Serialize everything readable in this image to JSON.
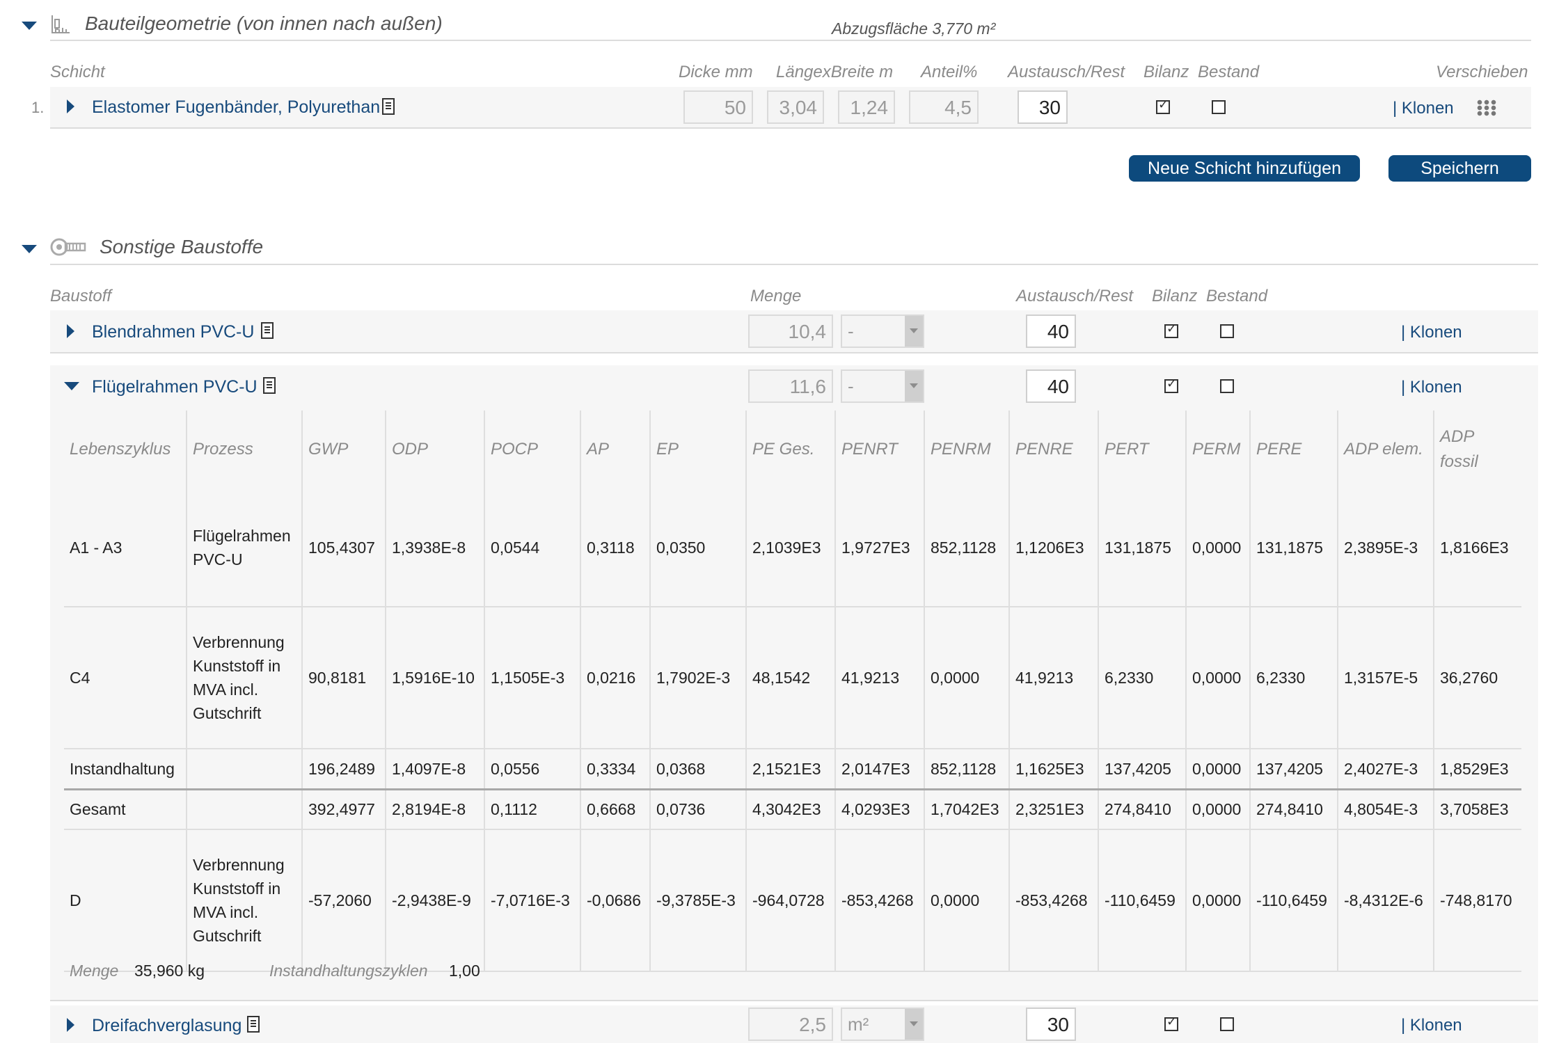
{
  "section1": {
    "title": "Bauteilgeometrie (von innen nach außen)",
    "deduction": "Abzugsfläche 3,770 m²",
    "headers": {
      "schicht": "Schicht",
      "dicke": "Dicke mm",
      "laenge_breite": "LängexBreite m",
      "anteil": "Anteil%",
      "austausch": "Austausch/Rest",
      "bilanz": "Bilanz",
      "bestand": "Bestand",
      "verschieben": "Verschieben"
    },
    "layer": {
      "index": "1.",
      "name": "Elastomer Fugenbänder, Polyurethan",
      "dicke": "50",
      "laenge": "3,04",
      "breite": "1,24",
      "anteil": "4,5",
      "austausch": "30",
      "bilanz": true,
      "bestand": false,
      "clone": "| Klonen"
    },
    "buttons": {
      "add_layer": "Neue Schicht hinzufügen",
      "save": "Speichern"
    }
  },
  "section2": {
    "title": "Sonstige Baustoffe",
    "headers": {
      "baustoff": "Baustoff",
      "menge": "Menge",
      "austausch": "Austausch/Rest",
      "bilanz": "Bilanz",
      "bestand": "Bestand"
    },
    "materials": [
      {
        "name": "Blendrahmen PVC-U",
        "menge": "10,4",
        "unit": "-",
        "austausch": "40",
        "bilanz": true,
        "bestand": false,
        "clone": "| Klonen"
      },
      {
        "name": "Flügelrahmen PVC-U",
        "menge": "11,6",
        "unit": "-",
        "austausch": "40",
        "bilanz": true,
        "bestand": false,
        "clone": "| Klonen"
      },
      {
        "name": "Dreifachverglasung",
        "menge": "2,5",
        "unit": "m²",
        "austausch": "30",
        "bilanz": true,
        "bestand": false,
        "clone": "| Klonen"
      }
    ],
    "lca_table": {
      "headers": [
        "Lebenszyklus",
        "Prozess",
        "GWP",
        "ODP",
        "POCP",
        "AP",
        "EP",
        "PE Ges.",
        "PENRT",
        "PENRM",
        "PENRE",
        "PERT",
        "PERM",
        "PERE",
        "ADP elem.",
        "ADP fossil"
      ],
      "rows": [
        {
          "cells": [
            "A1 - A3",
            "Flügelrahmen PVC-U",
            "105,4307",
            "1,3938E-8",
            "0,0544",
            "0,3118",
            "0,0350",
            "2,1039E3",
            "1,9727E3",
            "852,1128",
            "1,1206E3",
            "131,1875",
            "0,0000",
            "131,1875",
            "2,3895E-3",
            "1,8166E3"
          ]
        },
        {
          "cells": [
            "C4",
            "Verbrennung Kunststoff in MVA incl. Gutschrift",
            "90,8181",
            "1,5916E-10",
            "1,1505E-3",
            "0,0216",
            "1,7902E-3",
            "48,1542",
            "41,9213",
            "0,0000",
            "41,9213",
            "6,2330",
            "0,0000",
            "6,2330",
            "1,3157E-5",
            "36,2760"
          ]
        },
        {
          "cells": [
            "Instandhaltung",
            "",
            "196,2489",
            "1,4097E-8",
            "0,0556",
            "0,3334",
            "0,0368",
            "2,1521E3",
            "2,0147E3",
            "852,1128",
            "1,1625E3",
            "137,4205",
            "0,0000",
            "137,4205",
            "2,4027E-3",
            "1,8529E3"
          ]
        },
        {
          "cells": [
            "Gesamt",
            "",
            "392,4977",
            "2,8194E-8",
            "0,1112",
            "0,6668",
            "0,0736",
            "4,3042E3",
            "4,0293E3",
            "1,7042E3",
            "2,3251E3",
            "274,8410",
            "0,0000",
            "274,8410",
            "4,8054E-3",
            "3,7058E3"
          ]
        },
        {
          "cells": [
            "D",
            "Verbrennung Kunststoff in MVA incl. Gutschrift",
            "-57,2060",
            "-2,9438E-9",
            "-7,0716E-3",
            "-0,0686",
            "-9,3785E-3",
            "-964,0728",
            "-853,4268",
            "0,0000",
            "-853,4268",
            "-110,6459",
            "0,0000",
            "-110,6459",
            "-8,4312E-6",
            "-748,8170"
          ]
        }
      ]
    },
    "footer": {
      "menge_label": "Menge",
      "menge_value": "35,960 kg",
      "zyklen_label": "Instandhaltungszyklen",
      "zyklen_value": "1,00"
    }
  }
}
